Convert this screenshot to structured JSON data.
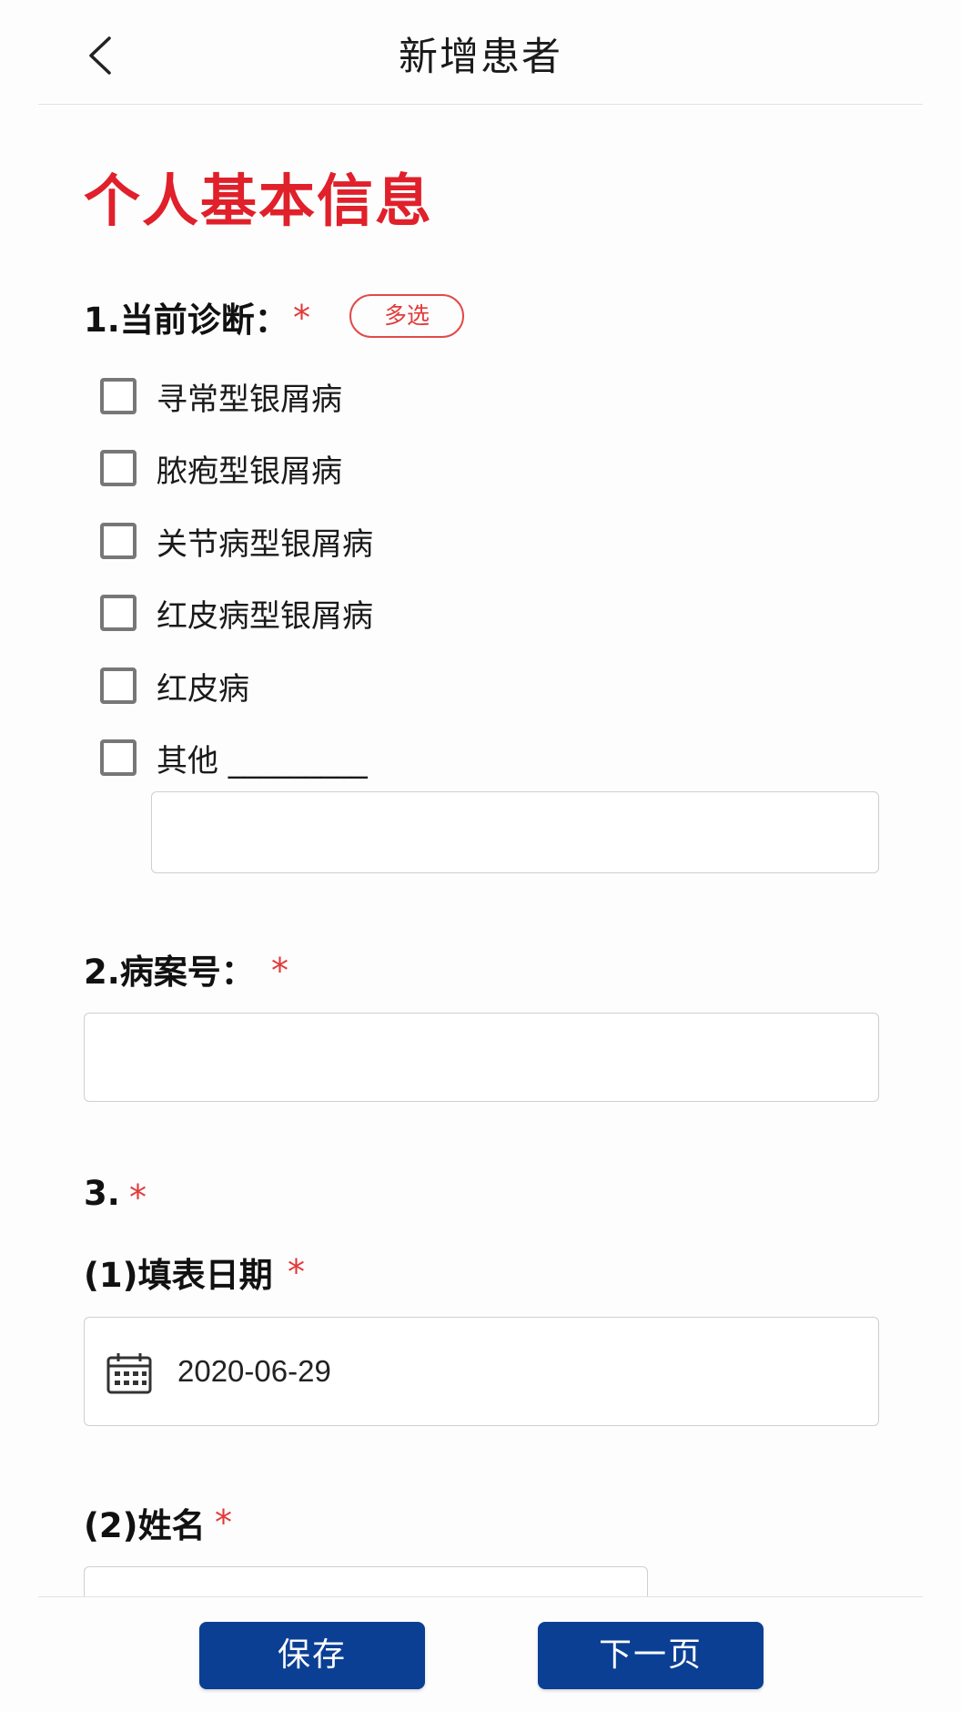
{
  "header": {
    "title": "新增患者"
  },
  "section": {
    "title": "个人基本信息"
  },
  "q1": {
    "label": "1.当前诊断：",
    "required_mark": "*",
    "badge": "多选",
    "options": [
      "寻常型银屑病",
      "脓疱型银屑病",
      "关节病型银屑病",
      "红皮病型银屑病",
      "红皮病",
      "其他 _________"
    ],
    "other_input_value": ""
  },
  "q2": {
    "label": "2.病案号：",
    "required_mark": "*",
    "value": ""
  },
  "q3": {
    "label": "3.",
    "required_mark": "*",
    "sub1": {
      "label": "(1)填表日期",
      "required_mark": "*",
      "value": "2020-06-29",
      "icon": "calendar-icon"
    },
    "sub2": {
      "label": "(2)姓名",
      "required_mark": "*",
      "value": ""
    }
  },
  "footer": {
    "save_label": "保存",
    "next_label": "下一页"
  },
  "colors": {
    "accent_red": "#e0202a",
    "button_blue": "#0b3f94"
  }
}
